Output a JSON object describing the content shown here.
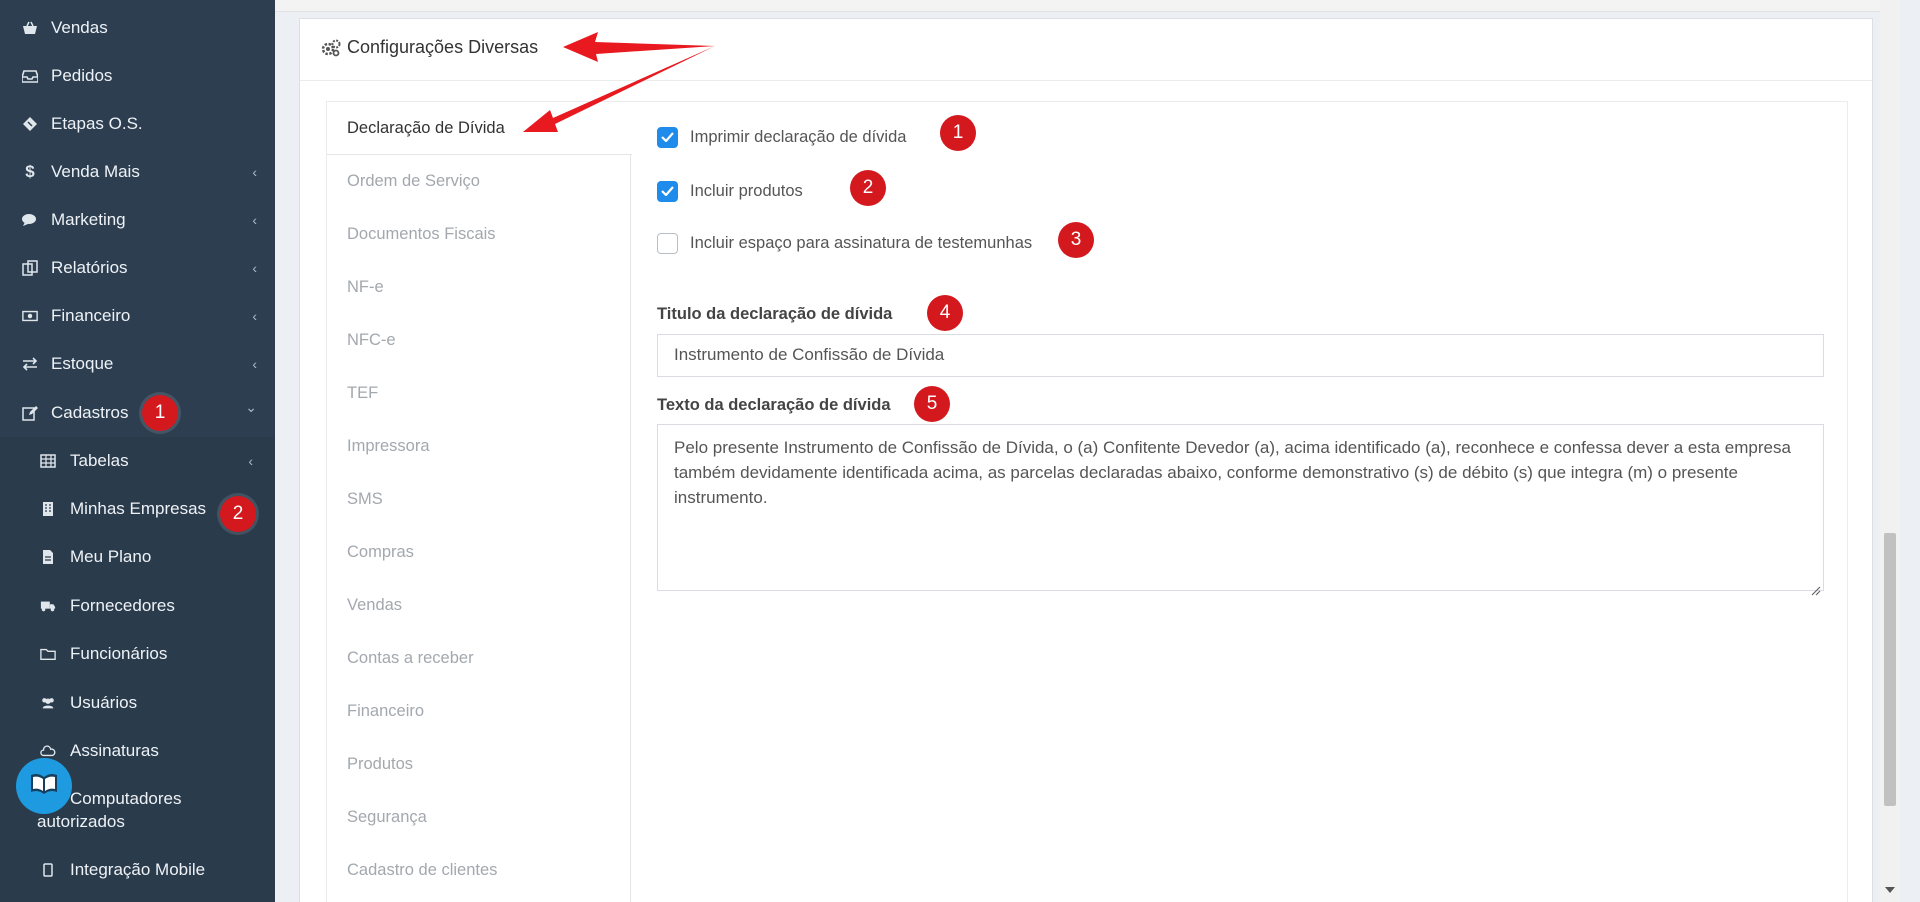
{
  "sidebar": {
    "items": [
      {
        "icon": "basket-icon",
        "label": "Vendas",
        "chevron": ""
      },
      {
        "icon": "inbox-icon",
        "label": "Pedidos",
        "chevron": ""
      },
      {
        "icon": "ticket-icon",
        "label": "Etapas O.S.",
        "chevron": ""
      },
      {
        "icon": "dollar-icon",
        "label": "Venda Mais",
        "chevron": "‹"
      },
      {
        "icon": "comments-icon",
        "label": "Marketing",
        "chevron": "‹"
      },
      {
        "icon": "copy-icon",
        "label": "Relatórios",
        "chevron": "‹"
      },
      {
        "icon": "money-icon",
        "label": "Financeiro",
        "chevron": "‹"
      },
      {
        "icon": "exchange-icon",
        "label": "Estoque",
        "chevron": "‹"
      },
      {
        "icon": "edit-icon",
        "label": "Cadastros",
        "chevron": "⌄"
      }
    ],
    "subitems": [
      {
        "icon": "table-icon",
        "label": "Tabelas",
        "chevron": "‹"
      },
      {
        "icon": "building-icon",
        "label": "Minhas Empresas",
        "chevron": ""
      },
      {
        "icon": "file-icon",
        "label": "Meu Plano",
        "chevron": ""
      },
      {
        "icon": "truck-icon",
        "label": "Fornecedores",
        "chevron": ""
      },
      {
        "icon": "folder-icon",
        "label": "Funcionários",
        "chevron": ""
      },
      {
        "icon": "users-icon",
        "label": "Usuários",
        "chevron": ""
      },
      {
        "icon": "cloud-icon",
        "label": "Assinaturas",
        "chevron": ""
      },
      {
        "icon": "desktop-icon",
        "label": "Computadores autorizados",
        "chevron": ""
      },
      {
        "icon": "mobile-icon",
        "label": "Integração Mobile",
        "chevron": ""
      }
    ],
    "badges": [
      "1",
      "2"
    ]
  },
  "panel": {
    "title": "Configurações Diversas"
  },
  "tabs": [
    "Declaração de Dívida",
    "Ordem de Serviço",
    "Documentos Fiscais",
    "NF-e",
    "NFC-e",
    "TEF",
    "Impressora",
    "SMS",
    "Compras",
    "Vendas",
    "Contas a receber",
    "Financeiro",
    "Produtos",
    "Segurança",
    "Cadastro de clientes"
  ],
  "form": {
    "checkboxes": [
      {
        "label": "Imprimir declaração de dívida",
        "checked": true
      },
      {
        "label": "Incluir produtos",
        "checked": true
      },
      {
        "label": "Incluir espaço para assinatura de testemunhas",
        "checked": false
      }
    ],
    "title_label": "Titulo da declaração de dívida",
    "title_value": "Instrumento de Confissão de Dívida",
    "text_label": "Texto da declaração de dívida",
    "text_value": "Pelo presente Instrumento de Confissão de Dívida, o (a) Confitente Devedor (a), acima identificado (a), reconhece e confessa dever a esta empresa também devidamente identificada acima, as parcelas declaradas abaixo, conforme demonstrativo (s) de débito (s) que integra (m) o presente instrumento.",
    "badges": [
      "1",
      "2",
      "3",
      "4",
      "5"
    ]
  },
  "colors": {
    "sidebar_bg": "#2c3e50",
    "accent_blue": "#1f8ceb",
    "badge_red": "#d3191e",
    "arrow_red": "#e8191f"
  }
}
